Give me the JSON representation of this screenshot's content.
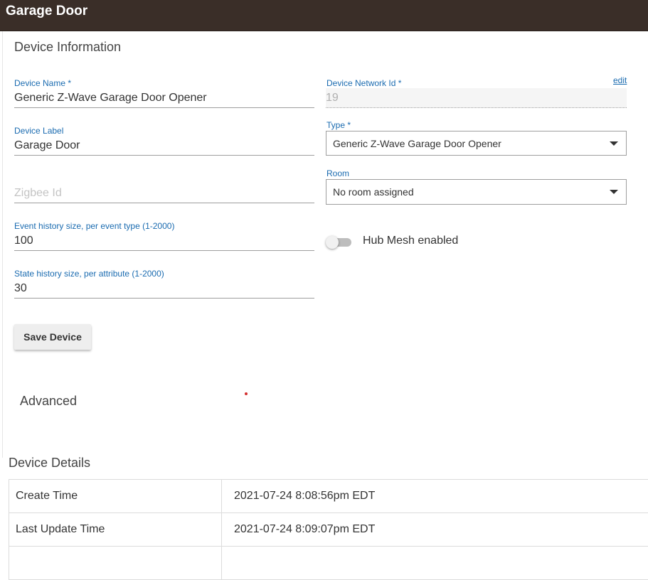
{
  "header": {
    "title": "Garage Door"
  },
  "device_info": {
    "title": "Device Information",
    "device_name": {
      "label": "Device Name *",
      "value": "Generic Z-Wave Garage Door Opener"
    },
    "device_network_id": {
      "label": "Device Network Id *",
      "value": "19",
      "edit_label": "edit"
    },
    "device_label": {
      "label": "Device Label",
      "value": "Garage Door"
    },
    "type": {
      "label": "Type *",
      "value": "Generic Z-Wave Garage Door Opener"
    },
    "room": {
      "label": "Room",
      "value": "No room assigned"
    },
    "zigbee_id": {
      "placeholder": "Zigbee Id"
    },
    "event_history": {
      "label": "Event history size, per event type (1-2000)",
      "value": "100"
    },
    "hub_mesh": {
      "label": "Hub Mesh enabled",
      "enabled": false
    },
    "state_history": {
      "label": "State history size, per attribute (1-2000)",
      "value": "30"
    },
    "save_label": "Save Device"
  },
  "advanced": {
    "title": "Advanced"
  },
  "device_details": {
    "title": "Device Details",
    "rows": [
      {
        "key": "Create Time",
        "value": "2021-07-24 8:08:56pm EDT"
      },
      {
        "key": "Last Update Time",
        "value": "2021-07-24 8:09:07pm EDT"
      },
      {
        "key": "",
        "value": ""
      }
    ]
  },
  "colors": {
    "header_bg": "#3a2e28",
    "label_blue": "#1a6bb0",
    "button_bg": "#eeeeee"
  }
}
